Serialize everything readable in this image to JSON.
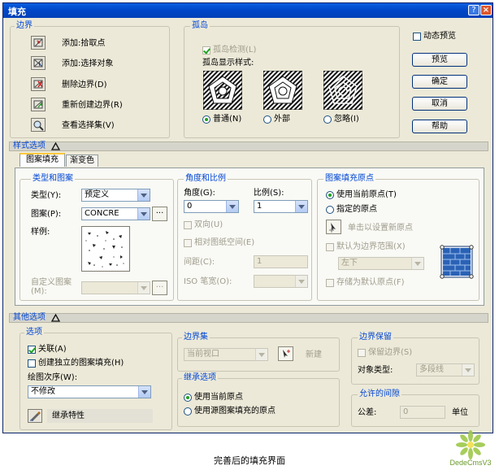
{
  "window": {
    "title": "填充"
  },
  "boundary": {
    "group_label": "边界",
    "add_pick": "添加:拾取点",
    "add_select": "添加:选择对象",
    "remove": "删除边界(D)",
    "recreate": "重新创建边界(R)",
    "view_sel": "查看选择集(V)"
  },
  "island": {
    "group_label": "孤岛",
    "detect": "孤岛检测(L)",
    "style_label": "孤岛显示样式:",
    "normal": "普通(N)",
    "outer": "外部",
    "ignore": "忽略(I)"
  },
  "right_buttons": {
    "dynamic_preview": "动态预览",
    "preview": "预览",
    "ok": "确定",
    "cancel": "取消",
    "help": "帮助"
  },
  "pattern_options": {
    "section_label": "样式选项",
    "tab_hatch": "图案填充",
    "tab_gradient": "渐变色",
    "type_group": "类型和图案",
    "type_label": "类型(Y):",
    "type_value": "预定义",
    "pattern_label": "图案(P):",
    "pattern_value": "CONCRE",
    "sample_label": "样例:",
    "custom_label": "自定义图案(M):",
    "angle_group": "角度和比例",
    "angle_label": "角度(G):",
    "angle_value": "0",
    "scale_label": "比例(S):",
    "scale_value": "1",
    "double": "双向(U)",
    "relative": "相对图纸空间(E)",
    "spacing_label": "间距(C):",
    "spacing_value": "1",
    "iso_label": "ISO 笔宽(O):",
    "origin_group": "图案填充原点",
    "use_current": "使用当前原点(T)",
    "specified": "指定的原点",
    "click_set": "单击以设置新原点",
    "default_extent": "默认为边界范围(X)",
    "extent_value": "左下",
    "store_default": "存储为默认原点(F)"
  },
  "other_options": {
    "section_label": "其他选项",
    "options_group": "选项",
    "associative": "关联(A)",
    "separate": "创建独立的图案填充(H)",
    "draw_order_label": "绘图次序(W):",
    "draw_order_value": "不修改",
    "inherit": "继承特性",
    "boundary_set_group": "边界集",
    "boundary_set_value": "当前视口",
    "new": "新建",
    "inherit_options_group": "继承选项",
    "inh_current": "使用当前原点",
    "inh_source": "使用源图案填充的原点",
    "retain_group": "边界保留",
    "retain": "保留边界(S)",
    "obj_type_label": "对象类型:",
    "obj_type_value": "多段线",
    "gap_group": "允许的间隙",
    "tolerance_label": "公差:",
    "tolerance_value": "0",
    "unit": "单位"
  },
  "caption": "完善后的填充界面",
  "watermark": "DedeCmsV3"
}
